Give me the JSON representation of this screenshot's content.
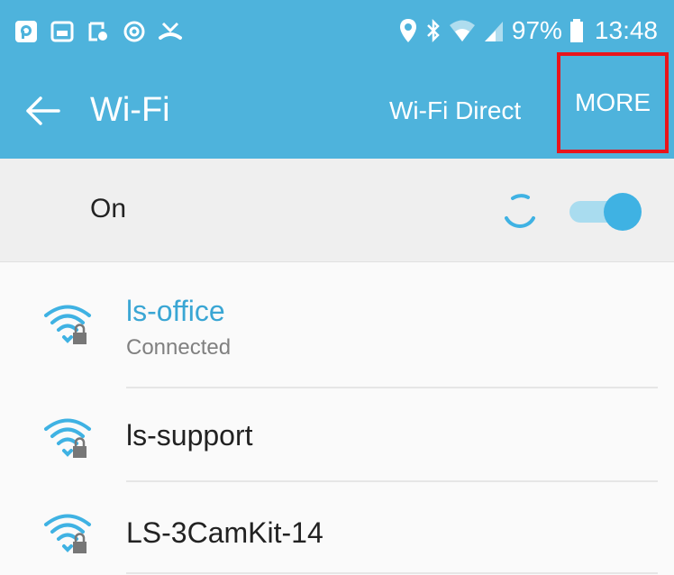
{
  "status_bar": {
    "notification_icons": [
      "p-app-icon",
      "gallery-icon",
      "screenshot-icon",
      "sync-icon",
      "missed-call-icon"
    ],
    "battery": "97%",
    "time": "13:48"
  },
  "toolbar": {
    "title": "Wi-Fi",
    "wifi_direct_label": "Wi-Fi Direct",
    "more_label": "MORE"
  },
  "on_row": {
    "label": "On",
    "toggle_state": "on"
  },
  "networks": [
    {
      "name": "ls-office",
      "status": "Connected",
      "secured": true,
      "connected": true
    },
    {
      "name": "ls-support",
      "status": "",
      "secured": true,
      "connected": false
    },
    {
      "name": "LS-3CamKit-14",
      "status": "",
      "secured": true,
      "connected": false
    }
  ],
  "colors": {
    "accent": "#4eb3dc",
    "connected_text": "#3aa6d4",
    "highlight_box": "#e8151c"
  }
}
